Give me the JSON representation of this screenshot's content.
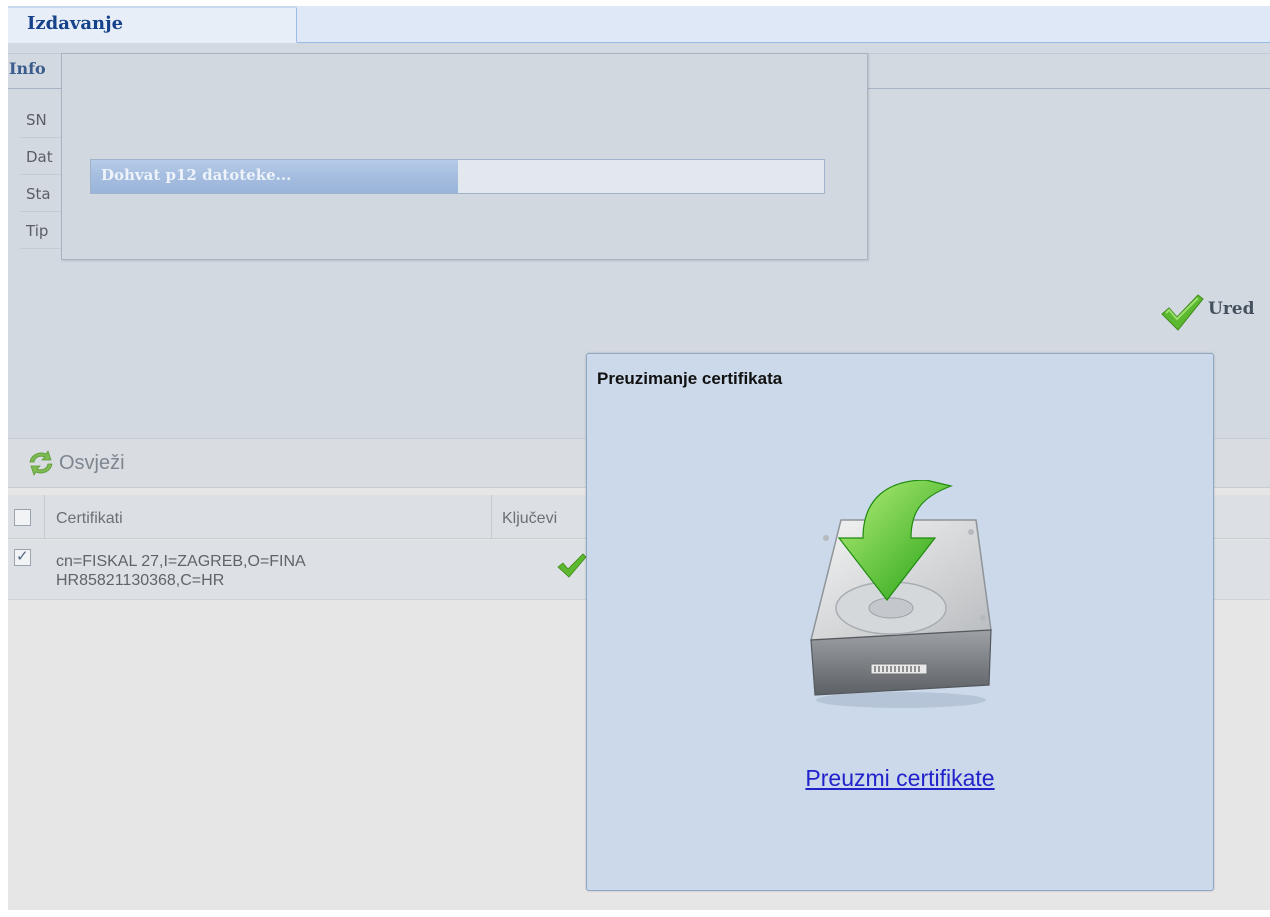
{
  "tab": {
    "label": "Izdavanje"
  },
  "info": {
    "header": "Info",
    "rows": [
      "SN",
      "Dat",
      "Sta",
      "Tip"
    ],
    "status_label": "Ured"
  },
  "loading": {
    "text": "Dohvat p12 datoteke...",
    "progress": 0.5
  },
  "toolbar": {
    "refresh_label": "Osvježi"
  },
  "grid": {
    "columns": [
      "Certifikati",
      "Ključevi"
    ],
    "rows": [
      {
        "certificate": "cn=FISKAL 27,I=ZAGREB,O=FINA HR85821130368,C=HR",
        "checked": true,
        "has_key": true
      }
    ]
  },
  "dialog": {
    "title": "Preuzimanje certifikata",
    "link_label": "Preuzmi certifikate"
  },
  "colors": {
    "accent_blue": "#15428b",
    "link": "#2222cc",
    "check_green": "#58b62b",
    "arrow_green": "#3fc01a"
  }
}
